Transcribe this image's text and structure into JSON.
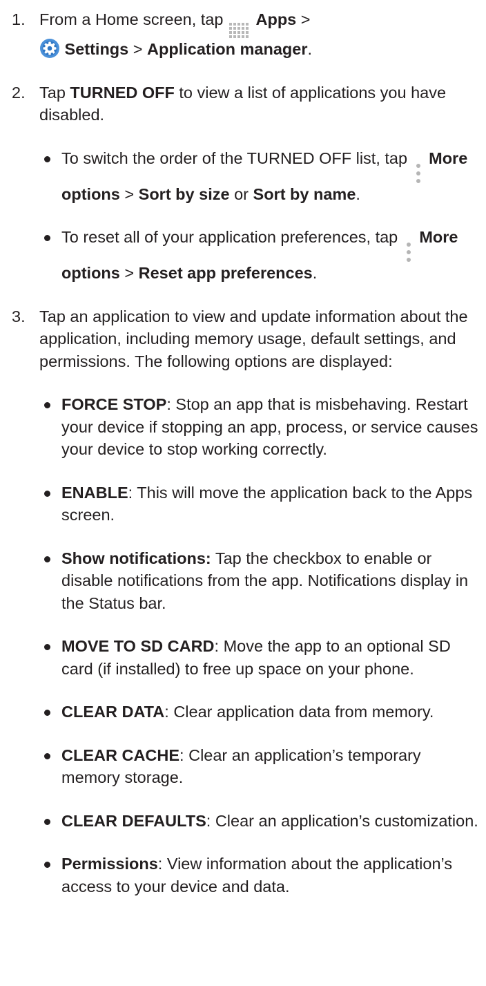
{
  "steps": [
    {
      "number": "1.",
      "line1_pre": "From a Home screen, tap",
      "apps": "Apps",
      "sep1": ">",
      "settings": "Settings",
      "sep2": ">",
      "app_manager": "Application manager",
      "end": ".",
      "apps_icon": "apps-grid-icon",
      "settings_icon": "settings-gear-icon"
    },
    {
      "number": "2.",
      "pre": "Tap",
      "bold": "TURNED OFF",
      "post": "to view a list of applications you have disabled.",
      "bullets": [
        {
          "pre": "To switch the order of the TURNED OFF list, tap",
          "icon": "more-options-icon",
          "b1": "More options",
          "sep": ">",
          "b2": "Sort by size",
          "or": "or",
          "b3": "Sort by name",
          "end": "."
        },
        {
          "pre": "To reset all of your application preferences, tap",
          "icon": "more-options-icon",
          "b1": "More options",
          "sep": ">",
          "b2": "Reset app preferences",
          "end": "."
        }
      ]
    },
    {
      "number": "3.",
      "text": "Tap an application to view and update information about the application, including memory usage, default settings, and permissions. The following options are displayed:",
      "bullets": [
        {
          "term": "FORCE STOP",
          "sep": ":",
          "desc": "Stop an app that is misbehaving. Restart your device if stopping an app, process, or service causes your device to stop working correctly."
        },
        {
          "term": "ENABLE",
          "sep": ":",
          "desc": "This will move the application back to the Apps screen."
        },
        {
          "term": "Show notifications:",
          "sep": "",
          "desc": "Tap the checkbox to enable or disable notifications from the app. Notifications display in the Status bar."
        },
        {
          "term": "MOVE TO SD CARD",
          "sep": ":",
          "desc": "Move the app to an optional SD card (if installed) to free up space on your phone."
        },
        {
          "term": "CLEAR DATA",
          "sep": ":",
          "desc": "Clear application data from memory."
        },
        {
          "term": "CLEAR CACHE",
          "sep": ":",
          "desc": "Clear an application’s temporary memory storage."
        },
        {
          "term": "CLEAR DEFAULTS",
          "sep": ":",
          "desc": "Clear an application’s customization."
        },
        {
          "term": "Permissions",
          "sep": ":",
          "desc": "View information about the application’s access to your device and data."
        }
      ]
    }
  ]
}
